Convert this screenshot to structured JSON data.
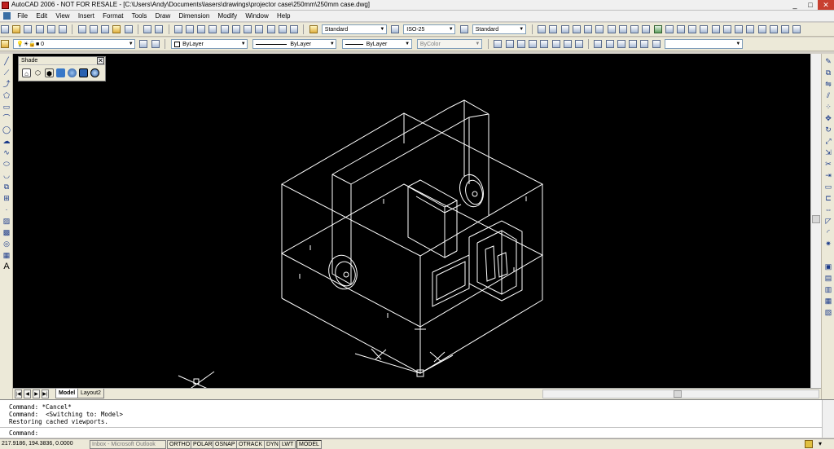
{
  "window": {
    "title": "AutoCAD 2006 - NOT FOR RESALE - [C:\\Users\\Andy\\Documents\\lasers\\drawings\\projector case\\250mm\\250mm case.dwg]",
    "min": "_",
    "max": "□",
    "close": "✕"
  },
  "menu": [
    "File",
    "Edit",
    "View",
    "Insert",
    "Format",
    "Tools",
    "Draw",
    "Dimension",
    "Modify",
    "Window",
    "Help"
  ],
  "styles": {
    "text_style": "Standard",
    "dim_style": "ISO-25",
    "table_style": "Standard"
  },
  "layer": {
    "current": "0"
  },
  "properties": {
    "color": "ByLayer",
    "linetype": "ByLayer",
    "lineweight": "ByLayer",
    "plotstyle": "ByColor"
  },
  "shade_toolbar": {
    "title": "Shade",
    "close": "✕"
  },
  "layout_tabs": {
    "nav": [
      "|◀",
      "◀",
      "▶",
      "▶|"
    ],
    "tabs": [
      "Model",
      "Layout2"
    ]
  },
  "command_history": [
    "Command: *Cancel*",
    "Command:  <Switching to: Model>",
    "Restoring cached viewports."
  ],
  "command_prompt": "Command:",
  "status": {
    "coords": "217.9186, 194.3836, 0.0000",
    "taskbar_item": "Inbox - Microsoft Outlook",
    "toggles": [
      "ORTHO",
      "POLAR",
      "OSNAP",
      "OTRACK",
      "DYN",
      "LWT",
      "MODEL"
    ]
  },
  "colors": {
    "drawing_bg": "#000000",
    "wireframe": "#ffffff",
    "ui_face": "#ece9d8"
  },
  "icons": {
    "left_draw": [
      "line-icon",
      "construction-line-icon",
      "polyline-icon",
      "polygon-icon",
      "rectangle-icon",
      "arc-icon",
      "circle-icon",
      "revision-cloud-icon",
      "spline-icon",
      "ellipse-icon",
      "ellipse-arc-icon",
      "insert-block-icon",
      "make-block-icon",
      "point-icon",
      "hatch-icon",
      "gradient-icon",
      "region-icon",
      "table-icon",
      "multiline-text-icon"
    ],
    "right_modify": [
      "erase-icon",
      "copy-icon",
      "mirror-icon",
      "offset-icon",
      "array-icon",
      "move-icon",
      "rotate-icon",
      "scale-icon",
      "stretch-icon",
      "trim-icon",
      "extend-icon",
      "break-at-point-icon",
      "break-icon",
      "join-icon",
      "chamfer-icon",
      "fillet-icon",
      "explode-icon"
    ],
    "right_extra": [
      "draworder-icon",
      "bring-front-icon",
      "send-back-icon",
      "bring-above-icon",
      "send-under-icon"
    ]
  }
}
